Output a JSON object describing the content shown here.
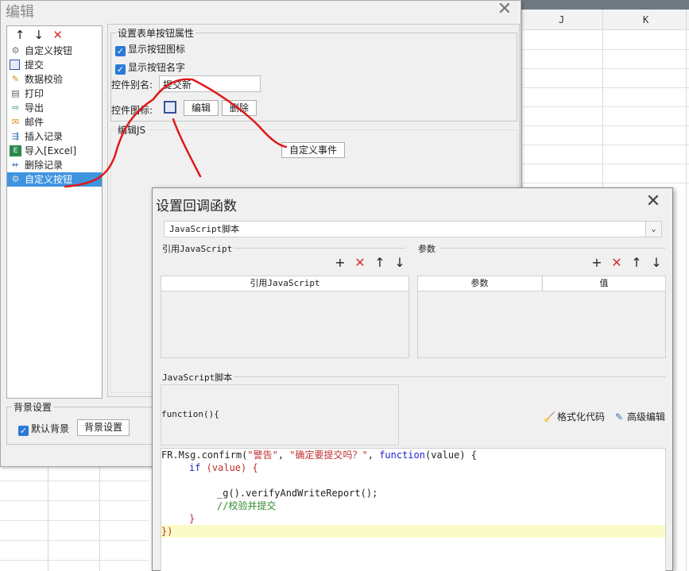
{
  "sheet": {
    "col_j": "J",
    "col_k": "K"
  },
  "edit_dialog": {
    "title": "编辑",
    "close": "✕",
    "list_toolbar": [
      "↑",
      "↓",
      "✕"
    ],
    "list_items": [
      {
        "label": "自定义按钮",
        "icon": "gear-icon"
      },
      {
        "label": "提交",
        "icon": "save-icon"
      },
      {
        "label": "数据校验",
        "icon": "pencil-icon"
      },
      {
        "label": "打印",
        "icon": "printer-icon"
      },
      {
        "label": "导出",
        "icon": "export-icon"
      },
      {
        "label": "邮件",
        "icon": "mail-icon"
      },
      {
        "label": "插入记录",
        "icon": "insert-record-icon"
      },
      {
        "label": "导入[Excel]",
        "icon": "excel-icon"
      },
      {
        "label": "删除记录",
        "icon": "delete-record-icon"
      },
      {
        "label": "自定义按钮",
        "icon": "gear-icon"
      }
    ],
    "props_group": "设置表单按钮属性",
    "show_icon": "显示按钮图标",
    "show_name": "显示按钮名字",
    "alias_label": "控件别名:",
    "alias_value": "提交新",
    "icon_label": "控件图标:",
    "edit_button": "编辑",
    "delete_button": "删除",
    "js_group": "编辑JS",
    "custom_event": "自定义事件",
    "bg_group": "背景设置",
    "default_bg": "默认背景",
    "bg_button": "背景设置"
  },
  "callback_dialog": {
    "title": "设置回调函数",
    "close": "✕",
    "script_type": "JavaScript脚本",
    "ref_js_label": "引用JavaScript",
    "params_label": "参数",
    "ref_js_header": "引用JavaScript",
    "param_header": "参数",
    "value_header": "值",
    "js_script_label": "JavaScript脚本",
    "fn_head": "function(){",
    "format_code": "格式化代码",
    "advanced_edit": "高级编辑",
    "code": {
      "l1_a": "FR.Msg.confirm(",
      "l1_s1": "\"警告\"",
      "l1_c": ", ",
      "l1_s2": "\"确定要提交吗？\"",
      "l1_d": ", ",
      "l1_kw": "function",
      "l1_e": "(value) {",
      "l2_kw": "if",
      "l2_rest": " (value) {",
      "l4": "_g().verifyAndWriteReport();",
      "l5": "//校验并提交",
      "l6": "}",
      "l7": "})"
    }
  },
  "colors": {
    "accent": "#3f94e0",
    "delete_red": "#d8302b",
    "annotation_red": "#e01818"
  }
}
